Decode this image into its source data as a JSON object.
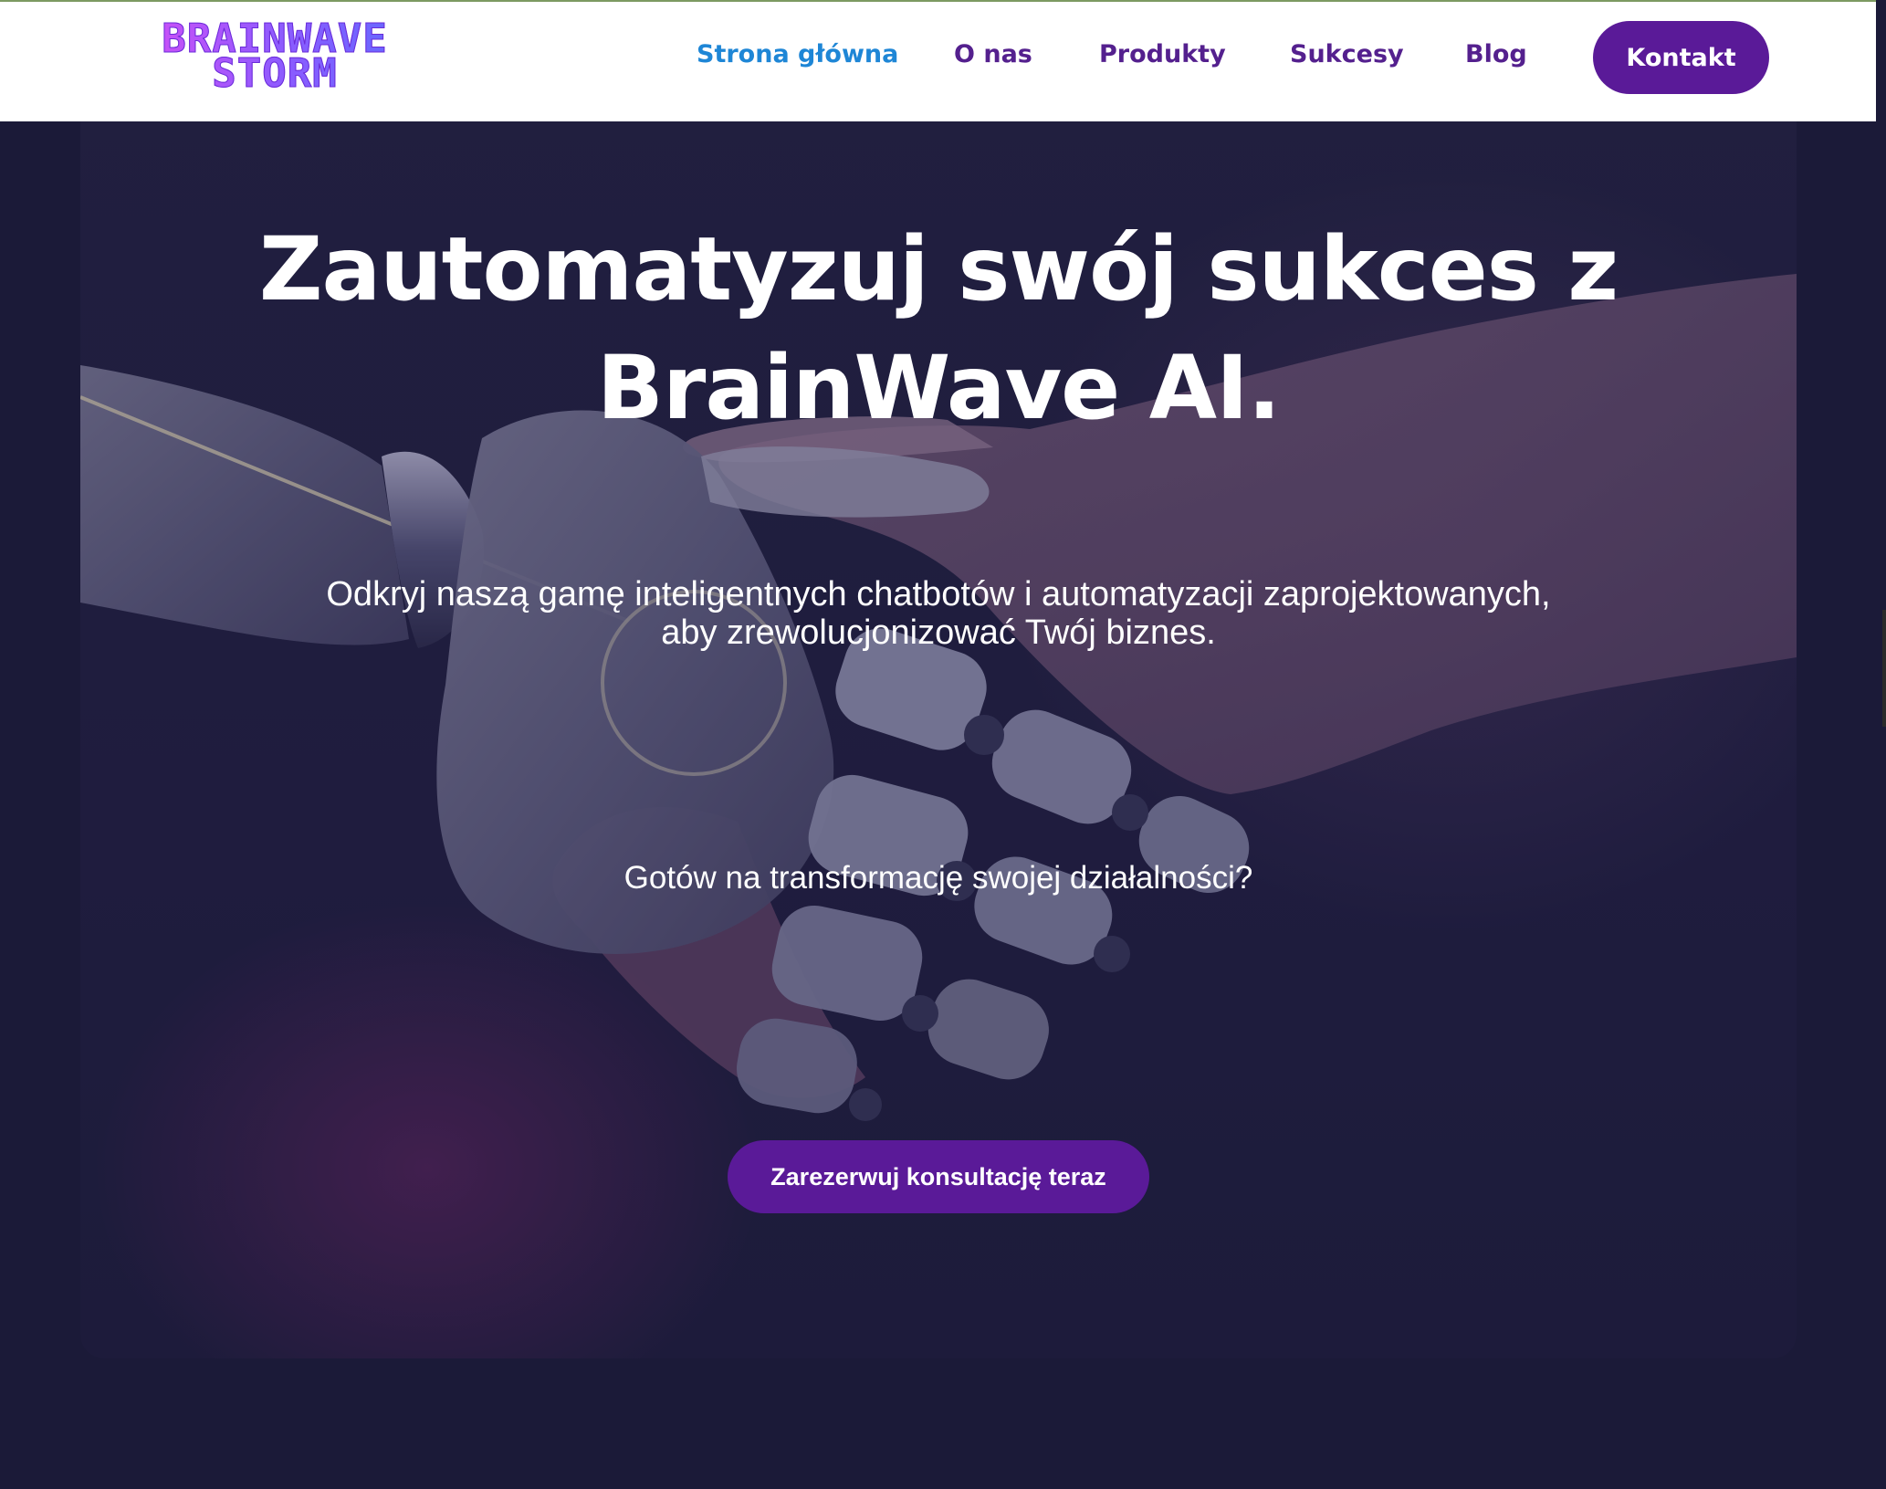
{
  "brand": {
    "logo_line1": "BRAINWAVE",
    "logo_line2": "STORM"
  },
  "nav": {
    "home": "Strona główna",
    "about": "O nas",
    "products": "Produkty",
    "success": "Sukcesy",
    "blog": "Blog",
    "contact": "Kontakt"
  },
  "hero": {
    "title_line1": "Zautomatyzuj swój sukces z",
    "title_line2": "BrainWave AI.",
    "subtitle_line1": "Odkryj naszą gamę inteligentnych chatbotów i automatyzacji zaprojektowanych,",
    "subtitle_line2": "aby zrewolucjonizować Twój biznes.",
    "question": "Gotów na transformację swojej działalności?",
    "cta": "Zarezerwuj konsultację teraz"
  },
  "colors": {
    "page_bg": "#1b1a38",
    "nav_text": "#54208e",
    "nav_active": "#1e86d6",
    "button_bg": "#5a1a98",
    "hero_text": "#ffffff"
  }
}
